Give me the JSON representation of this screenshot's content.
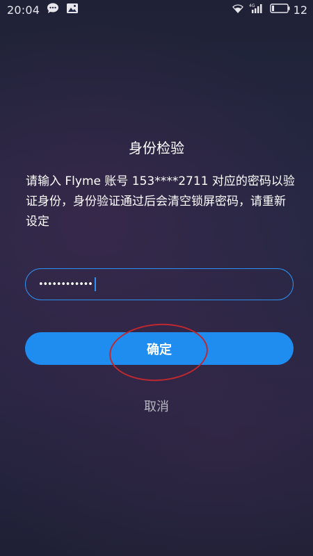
{
  "status_bar": {
    "time": "20:04",
    "battery_level": "12",
    "icons": [
      "message-icon",
      "image-icon",
      "wifi-icon",
      "signal-4g-icon",
      "battery-icon"
    ]
  },
  "dialog": {
    "title": "身份检验",
    "description": "请输入 Flyme 账号 153****2711 对应的密码以验证身份，身份验证通过后会清空锁屏密码，请重新设定",
    "password_value": "••••••••••••",
    "confirm_label": "确定",
    "cancel_label": "取消"
  },
  "colors": {
    "accent": "#1f8cf0",
    "annotation": "#c0282f"
  }
}
